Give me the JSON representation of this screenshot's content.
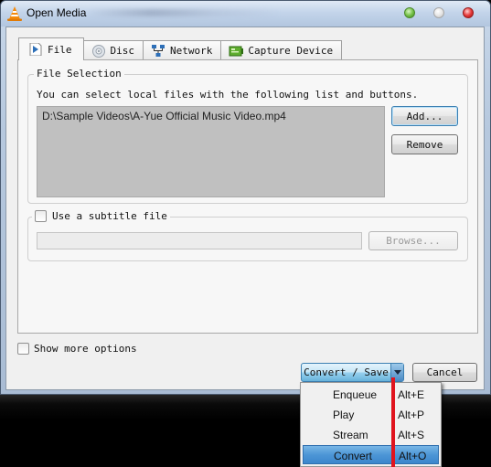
{
  "window": {
    "title": "Open Media",
    "app_icon": "vlc-cone-icon",
    "controls": [
      "minimize",
      "maximize",
      "close"
    ]
  },
  "tabs": [
    {
      "label": "File",
      "icon": "file-play-icon",
      "active": true
    },
    {
      "label": "Disc",
      "icon": "disc-icon",
      "active": false
    },
    {
      "label": "Network",
      "icon": "network-icon",
      "active": false
    },
    {
      "label": "Capture Device",
      "icon": "capture-card-icon",
      "active": false
    }
  ],
  "file_selection": {
    "title": "File Selection",
    "description": "You can select local files with the following list and buttons.",
    "files": [
      "D:\\Sample Videos\\A-Yue Official Music Video.mp4"
    ],
    "add_label": "Add...",
    "remove_label": "Remove"
  },
  "subtitle": {
    "checkbox_label": "Use a subtitle file",
    "checked": false,
    "path_value": "",
    "browse_label": "Browse..."
  },
  "show_more_options": {
    "label": "Show more options",
    "checked": false
  },
  "actions": {
    "convert_save_label": "Convert / Save",
    "cancel_label": "Cancel"
  },
  "dropdown_menu": {
    "items": [
      {
        "label": "Enqueue",
        "shortcut": "Alt+E",
        "highlighted": false
      },
      {
        "label": "Play",
        "shortcut": "Alt+P",
        "highlighted": false
      },
      {
        "label": "Stream",
        "shortcut": "Alt+S",
        "highlighted": false
      },
      {
        "label": "Convert",
        "shortcut": "Alt+O",
        "highlighted": true
      }
    ]
  },
  "colors": {
    "highlight": "#3b86cc",
    "annotation_marker": "#e0141e",
    "file_list_bg": "#c0c0c0"
  }
}
